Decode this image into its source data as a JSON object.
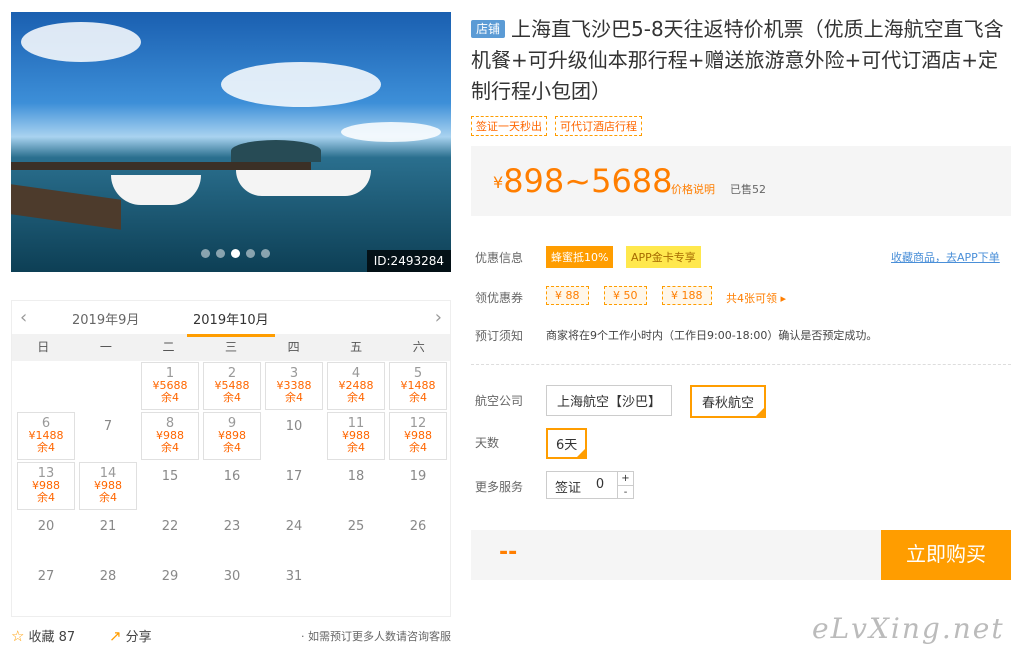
{
  "photo": {
    "id_label": "ID:2493284",
    "dots": 5,
    "active_dot": 3
  },
  "title": {
    "shop_tag": "店铺",
    "text": "上海直飞沙巴5-8天往返特价机票（优质上海航空直飞含机餐+可升级仙本那行程+赠送旅游意外险+可代订酒店+定制行程小包团）"
  },
  "tags": [
    "签证一天秒出",
    "可代订酒店行程"
  ],
  "price": {
    "currency": "¥",
    "range": "898~5688",
    "explain": "价格说明",
    "sold": "已售52"
  },
  "offers": {
    "label": "优惠信息",
    "chip1": "蜂蜜抵10%",
    "chip2": "APP金卡专享",
    "collect": "收藏商品，去APP下单"
  },
  "coupons": {
    "label": "领优惠券",
    "items": [
      "¥ 88",
      "¥ 50",
      "¥ 188"
    ],
    "more": "共4张可领"
  },
  "notice": {
    "label": "预订须知",
    "text": "商家将在9个工作小时内（工作日9:00-18:00）确认是否预定成功。"
  },
  "airline": {
    "label": "航空公司",
    "options": [
      "上海航空【沙巴】",
      "春秋航空"
    ]
  },
  "days": {
    "label": "天数",
    "option": "6天"
  },
  "services": {
    "label": "更多服务",
    "name": "签证",
    "value": "0",
    "plus": "+",
    "minus": "-"
  },
  "buy": {
    "dash": "--",
    "button": "立即购买"
  },
  "calendar": {
    "prev_month": "2019年9月",
    "cur_month": "2019年10月",
    "prev_arrow": "‹",
    "next_arrow": "›",
    "weekdays": [
      "日",
      "一",
      "二",
      "三",
      "四",
      "五",
      "六"
    ],
    "days": [
      {
        "d": ""
      },
      {
        "d": ""
      },
      {
        "d": "1",
        "p": "¥5688",
        "l": "余4"
      },
      {
        "d": "2",
        "p": "¥5488",
        "l": "余4"
      },
      {
        "d": "3",
        "p": "¥3388",
        "l": "余4"
      },
      {
        "d": "4",
        "p": "¥2488",
        "l": "余4"
      },
      {
        "d": "5",
        "p": "¥1488",
        "l": "余4"
      },
      {
        "d": "6",
        "p": "¥1488",
        "l": "余4"
      },
      {
        "d": "7"
      },
      {
        "d": "8",
        "p": "¥988",
        "l": "余4"
      },
      {
        "d": "9",
        "p": "¥898",
        "l": "余4"
      },
      {
        "d": "10"
      },
      {
        "d": "11",
        "p": "¥988",
        "l": "余4"
      },
      {
        "d": "12",
        "p": "¥988",
        "l": "余4"
      },
      {
        "d": "13",
        "p": "¥988",
        "l": "余4"
      },
      {
        "d": "14",
        "p": "¥988",
        "l": "余4"
      },
      {
        "d": "15"
      },
      {
        "d": "16"
      },
      {
        "d": "17"
      },
      {
        "d": "18"
      },
      {
        "d": "19"
      },
      {
        "d": "20"
      },
      {
        "d": "21"
      },
      {
        "d": "22"
      },
      {
        "d": "23"
      },
      {
        "d": "24"
      },
      {
        "d": "25"
      },
      {
        "d": "26"
      },
      {
        "d": "27"
      },
      {
        "d": "28"
      },
      {
        "d": "29"
      },
      {
        "d": "30"
      },
      {
        "d": "31"
      }
    ]
  },
  "footer": {
    "fav": "收藏 87",
    "share": "分享",
    "note": "· 如需预订更多人数请咨询客服"
  },
  "watermark": "eLvXing.net"
}
